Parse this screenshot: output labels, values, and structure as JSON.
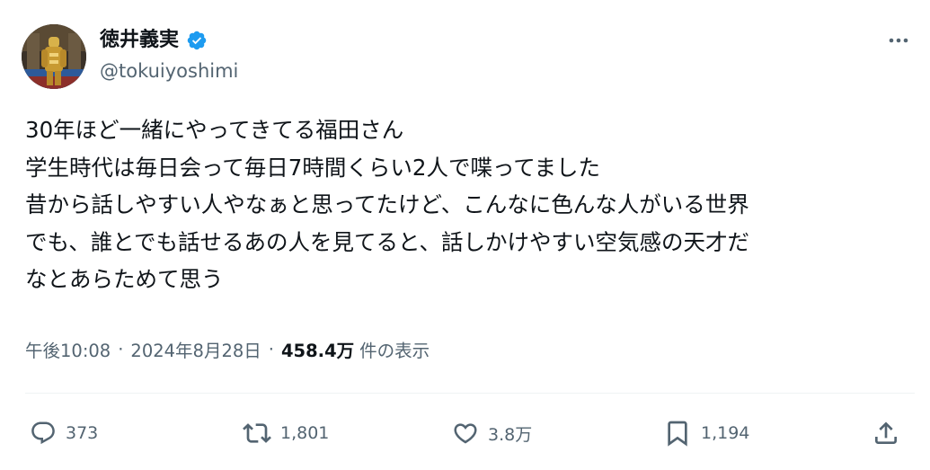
{
  "author": {
    "display_name": "徳井義実",
    "handle": "@tokuiyoshimi",
    "verified": true
  },
  "tweet": {
    "lines": [
      "30年ほど一緒にやってきてる福田さん",
      "学生時代は毎日会って毎日7時間くらい2人で喋ってました",
      "昔から話しやすい人やなぁと思ってたけど、こんなに色んな人がいる世界",
      "でも、誰とでも話せるあの人を見てると、話しかけやすい空気感の天才だ",
      "なとあらためて思う"
    ],
    "time": "午後10:08",
    "separator": "·",
    "date": "2024年8月28日",
    "views_count": "458.4万",
    "views_label": "件の表示"
  },
  "actions": {
    "replies": "373",
    "reposts": "1,801",
    "likes": "3.8万",
    "bookmarks": "1,194"
  },
  "icons": {
    "verified": "verified-badge-icon",
    "more": "more-icon",
    "reply": "reply-icon",
    "repost": "repost-icon",
    "like": "heart-icon",
    "bookmark": "bookmark-icon",
    "share": "share-icon"
  },
  "colors": {
    "text": "#0f1419",
    "secondary": "#536471",
    "verified": "#1d9bf0",
    "divider": "#eff3f4"
  }
}
